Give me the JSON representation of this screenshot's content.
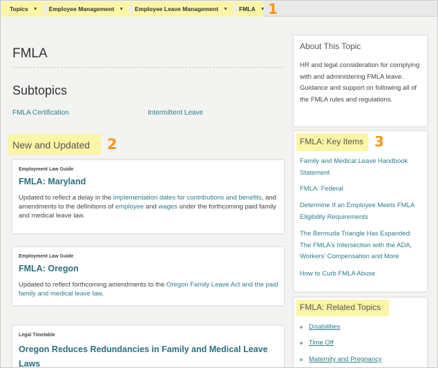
{
  "breadcrumb": {
    "items": [
      {
        "label": "Topics"
      },
      {
        "label": "Employee Management"
      },
      {
        "label": "Employee Leave Management"
      },
      {
        "label": "FMLA"
      }
    ]
  },
  "callouts": [
    "1",
    "2",
    "3"
  ],
  "main": {
    "page_title": "FMLA",
    "subtopics_title": "Subtopics",
    "subtopics": [
      "FMLA Certification",
      "Intermittent Leave"
    ],
    "new_updated_title": "New and Updated",
    "cards": [
      {
        "kind": "Employment Law Guide",
        "title": "FMLA: Maryland",
        "body_parts": [
          {
            "text": "Updated to reflect a delay in the ",
            "link": false
          },
          {
            "text": "implementation dates for contributions and benefits",
            "link": true
          },
          {
            "text": ", and amendments to the definitions of ",
            "link": false
          },
          {
            "text": "employee",
            "link": true
          },
          {
            "text": " and ",
            "link": false
          },
          {
            "text": "wages",
            "link": true
          },
          {
            "text": " under the forthcoming paid family and medical leave law.",
            "link": false
          }
        ]
      },
      {
        "kind": "Employment Law Guide",
        "title": "FMLA: Oregon",
        "body_parts": [
          {
            "text": "Updated to reflect forthcoming amendments to the ",
            "link": false
          },
          {
            "text": "Oregon Family Leave Act and the paid family and medical leave law",
            "link": true
          },
          {
            "text": ".",
            "link": false
          }
        ]
      },
      {
        "kind": "Legal Timetable",
        "title": "Oregon Reduces Redundancies in Family and Medical Leave Laws"
      }
    ]
  },
  "sidebar": {
    "about": {
      "title": "About This Topic",
      "body": "HR and legal consideration for complying with and administering FMLA leave. Guidance and support on following all of the FMLA rules and regulations."
    },
    "key_items": {
      "title": "FMLA: Key Items",
      "items": [
        "Family and Medical Leave Handbook Statement",
        "FMLA: Federal",
        "Determine If an Employee Meets FMLA Eligibility Requirements",
        "The Bermuda Triangle Has Expanded: The FMLA's Intersection with the ADA, Workers' Compensation and More",
        "How to Curb FMLA Abuse"
      ]
    },
    "related": {
      "title": "FMLA: Related Topics",
      "items": [
        "Disabilities",
        "Time Off",
        "Maternity and Pregnancy"
      ]
    }
  },
  "colors": {
    "highlight": "#fbf5a6",
    "link": "#2a7d8c",
    "callout": "#f7941d"
  }
}
